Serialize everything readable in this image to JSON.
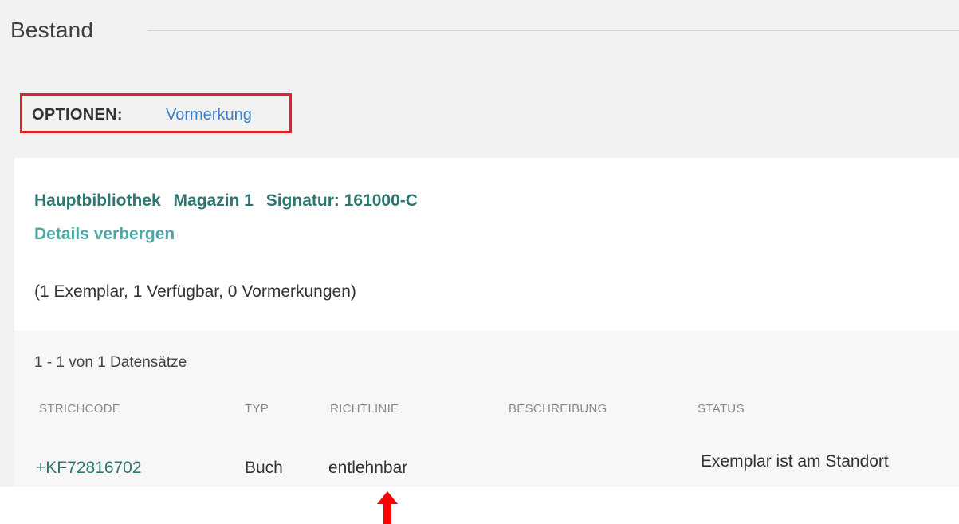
{
  "section": {
    "title": "Bestand"
  },
  "options": {
    "label": "OPTIONEN:",
    "link": "Vormerkung"
  },
  "holding": {
    "library": "Hauptbibliothek",
    "location": "Magazin 1",
    "signature": "Signatur: 161000-C",
    "details_link": "Details verbergen",
    "summary": "(1 Exemplar, 1 Verfügbar, 0 Vormerkungen)"
  },
  "items": {
    "records": "1 - 1 von 1 Datensätze",
    "columns": [
      "STRICHCODE",
      "TYP",
      "RICHTLINIE",
      "BESCHREIBUNG",
      "STATUS"
    ],
    "rows": [
      {
        "barcode": "+KF72816702",
        "type": "Buch",
        "policy": "entlehnbar",
        "description": "",
        "status": "Exemplar ist am Standort"
      }
    ]
  },
  "colors": {
    "highlight_box": "#e41f26",
    "link_blue": "#3d7fc9",
    "teal": "#2d7770",
    "teal_light": "#4fa7a5",
    "arrow": "#ff0000"
  },
  "annotations": {
    "arrow_icon": "arrow-up-icon"
  }
}
